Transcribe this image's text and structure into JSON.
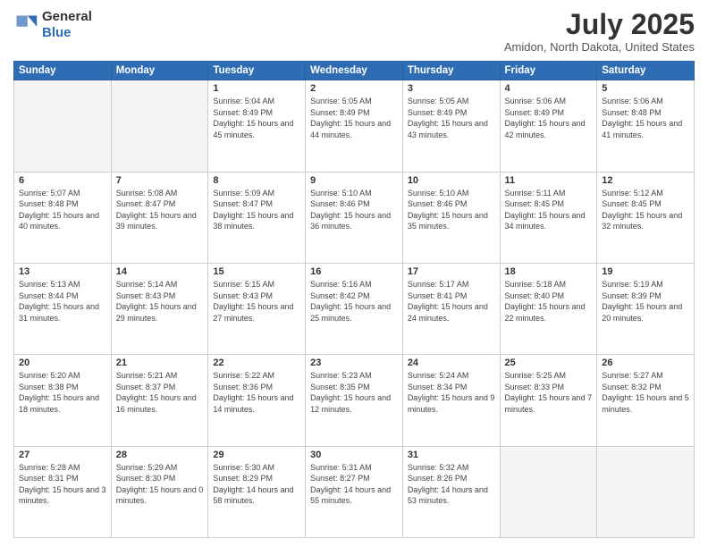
{
  "header": {
    "logo_line1": "General",
    "logo_line2": "Blue",
    "month_year": "July 2025",
    "location": "Amidon, North Dakota, United States"
  },
  "days_of_week": [
    "Sunday",
    "Monday",
    "Tuesday",
    "Wednesday",
    "Thursday",
    "Friday",
    "Saturday"
  ],
  "weeks": [
    [
      {
        "day": "",
        "empty": true
      },
      {
        "day": "",
        "empty": true
      },
      {
        "day": "1",
        "sunrise": "5:04 AM",
        "sunset": "8:49 PM",
        "daylight": "15 hours and 45 minutes."
      },
      {
        "day": "2",
        "sunrise": "5:05 AM",
        "sunset": "8:49 PM",
        "daylight": "15 hours and 44 minutes."
      },
      {
        "day": "3",
        "sunrise": "5:05 AM",
        "sunset": "8:49 PM",
        "daylight": "15 hours and 43 minutes."
      },
      {
        "day": "4",
        "sunrise": "5:06 AM",
        "sunset": "8:49 PM",
        "daylight": "15 hours and 42 minutes."
      },
      {
        "day": "5",
        "sunrise": "5:06 AM",
        "sunset": "8:48 PM",
        "daylight": "15 hours and 41 minutes."
      }
    ],
    [
      {
        "day": "6",
        "sunrise": "5:07 AM",
        "sunset": "8:48 PM",
        "daylight": "15 hours and 40 minutes."
      },
      {
        "day": "7",
        "sunrise": "5:08 AM",
        "sunset": "8:47 PM",
        "daylight": "15 hours and 39 minutes."
      },
      {
        "day": "8",
        "sunrise": "5:09 AM",
        "sunset": "8:47 PM",
        "daylight": "15 hours and 38 minutes."
      },
      {
        "day": "9",
        "sunrise": "5:10 AM",
        "sunset": "8:46 PM",
        "daylight": "15 hours and 36 minutes."
      },
      {
        "day": "10",
        "sunrise": "5:10 AM",
        "sunset": "8:46 PM",
        "daylight": "15 hours and 35 minutes."
      },
      {
        "day": "11",
        "sunrise": "5:11 AM",
        "sunset": "8:45 PM",
        "daylight": "15 hours and 34 minutes."
      },
      {
        "day": "12",
        "sunrise": "5:12 AM",
        "sunset": "8:45 PM",
        "daylight": "15 hours and 32 minutes."
      }
    ],
    [
      {
        "day": "13",
        "sunrise": "5:13 AM",
        "sunset": "8:44 PM",
        "daylight": "15 hours and 31 minutes."
      },
      {
        "day": "14",
        "sunrise": "5:14 AM",
        "sunset": "8:43 PM",
        "daylight": "15 hours and 29 minutes."
      },
      {
        "day": "15",
        "sunrise": "5:15 AM",
        "sunset": "8:43 PM",
        "daylight": "15 hours and 27 minutes."
      },
      {
        "day": "16",
        "sunrise": "5:16 AM",
        "sunset": "8:42 PM",
        "daylight": "15 hours and 25 minutes."
      },
      {
        "day": "17",
        "sunrise": "5:17 AM",
        "sunset": "8:41 PM",
        "daylight": "15 hours and 24 minutes."
      },
      {
        "day": "18",
        "sunrise": "5:18 AM",
        "sunset": "8:40 PM",
        "daylight": "15 hours and 22 minutes."
      },
      {
        "day": "19",
        "sunrise": "5:19 AM",
        "sunset": "8:39 PM",
        "daylight": "15 hours and 20 minutes."
      }
    ],
    [
      {
        "day": "20",
        "sunrise": "5:20 AM",
        "sunset": "8:38 PM",
        "daylight": "15 hours and 18 minutes."
      },
      {
        "day": "21",
        "sunrise": "5:21 AM",
        "sunset": "8:37 PM",
        "daylight": "15 hours and 16 minutes."
      },
      {
        "day": "22",
        "sunrise": "5:22 AM",
        "sunset": "8:36 PM",
        "daylight": "15 hours and 14 minutes."
      },
      {
        "day": "23",
        "sunrise": "5:23 AM",
        "sunset": "8:35 PM",
        "daylight": "15 hours and 12 minutes."
      },
      {
        "day": "24",
        "sunrise": "5:24 AM",
        "sunset": "8:34 PM",
        "daylight": "15 hours and 9 minutes."
      },
      {
        "day": "25",
        "sunrise": "5:25 AM",
        "sunset": "8:33 PM",
        "daylight": "15 hours and 7 minutes."
      },
      {
        "day": "26",
        "sunrise": "5:27 AM",
        "sunset": "8:32 PM",
        "daylight": "15 hours and 5 minutes."
      }
    ],
    [
      {
        "day": "27",
        "sunrise": "5:28 AM",
        "sunset": "8:31 PM",
        "daylight": "15 hours and 3 minutes."
      },
      {
        "day": "28",
        "sunrise": "5:29 AM",
        "sunset": "8:30 PM",
        "daylight": "15 hours and 0 minutes."
      },
      {
        "day": "29",
        "sunrise": "5:30 AM",
        "sunset": "8:29 PM",
        "daylight": "14 hours and 58 minutes."
      },
      {
        "day": "30",
        "sunrise": "5:31 AM",
        "sunset": "8:27 PM",
        "daylight": "14 hours and 55 minutes."
      },
      {
        "day": "31",
        "sunrise": "5:32 AM",
        "sunset": "8:26 PM",
        "daylight": "14 hours and 53 minutes."
      },
      {
        "day": "",
        "empty": true
      },
      {
        "day": "",
        "empty": true
      }
    ]
  ]
}
